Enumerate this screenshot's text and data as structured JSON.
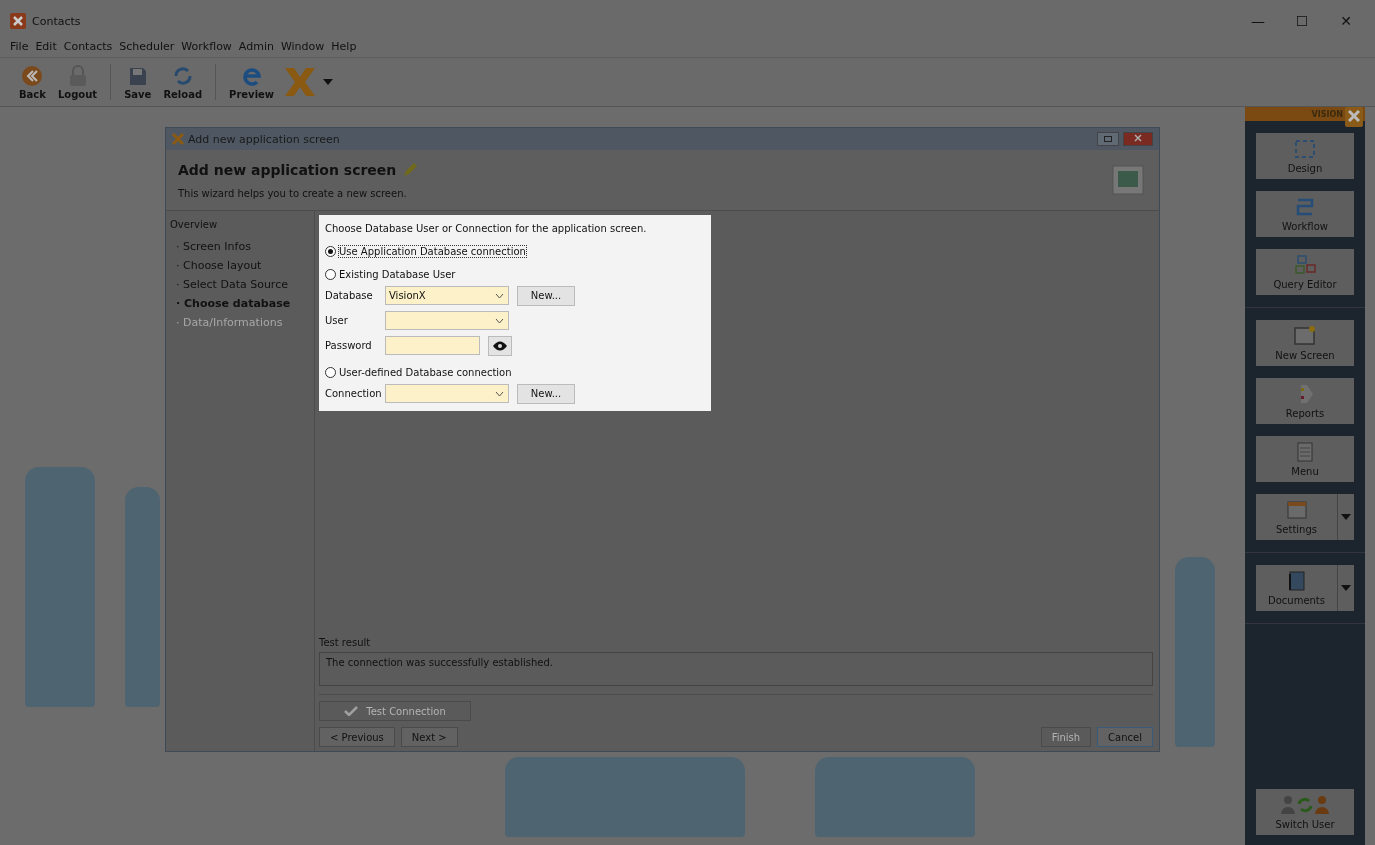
{
  "window": {
    "title": "Contacts",
    "controls": [
      "—",
      "☐",
      "✕"
    ]
  },
  "menu": [
    "File",
    "Edit",
    "Contacts",
    "Scheduler",
    "Workflow",
    "Admin",
    "Window",
    "Help"
  ],
  "toolbar": [
    {
      "kind": "back",
      "label": "Back"
    },
    {
      "kind": "lock",
      "label": "Logout"
    },
    {
      "kind": "sep"
    },
    {
      "kind": "save",
      "label": "Save"
    },
    {
      "kind": "reload",
      "label": "Reload"
    },
    {
      "kind": "sep"
    },
    {
      "kind": "preview",
      "label": "Preview"
    },
    {
      "kind": "logo"
    },
    {
      "kind": "caret"
    }
  ],
  "dialog": {
    "title": "Add new application screen",
    "heading": "Add new application screen",
    "subtitle": "This wizard helps you to create a new screen.",
    "nav_title": "Overview",
    "nav": [
      {
        "label": "· Screen Infos",
        "selected": false,
        "disabled": false
      },
      {
        "label": "· Choose layout",
        "selected": false,
        "disabled": false
      },
      {
        "label": "· Select Data Source",
        "selected": false,
        "disabled": false
      },
      {
        "label": "· Choose database",
        "selected": true,
        "disabled": false
      },
      {
        "label": "· Data/Informations",
        "selected": false,
        "disabled": true
      }
    ],
    "prompt": "Choose Database User or Connection for the application screen.",
    "sections": [
      {
        "label": "Use Application Database connection",
        "selected": true
      },
      {
        "label": "Existing Database User",
        "selected": false,
        "fields": [
          {
            "kind": "combo",
            "label": "Database",
            "value": "VisionX",
            "button": "New..."
          },
          {
            "kind": "combo",
            "label": "User"
          },
          {
            "kind": "password",
            "label": "Password"
          }
        ]
      },
      {
        "label": "User-defined Database connection",
        "selected": false,
        "fields": [
          {
            "kind": "combo",
            "label": "Connection",
            "button": "New..."
          }
        ]
      }
    ],
    "result_label": "Test result",
    "result_text": "The connection was successfully established.",
    "test_button": {
      "label": "Test Connection",
      "disabled": true
    },
    "left_buttons": [
      {
        "label": "< Previous",
        "disabled": false
      },
      {
        "label": "Next >",
        "disabled": false
      }
    ],
    "right_buttons": [
      {
        "label": "Finish",
        "disabled": true
      },
      {
        "label": "Cancel",
        "disabled": false
      }
    ]
  },
  "sidebar": {
    "brand": "VISION",
    "groups": [
      [
        {
          "kind": "design",
          "label": "Design",
          "dropdown": false
        },
        {
          "kind": "workflow",
          "label": "Workflow",
          "dropdown": false
        },
        {
          "kind": "query",
          "label": "Query Editor",
          "dropdown": false
        }
      ],
      [
        {
          "kind": "screen",
          "label": "New Screen",
          "dropdown": false
        },
        {
          "kind": "reports",
          "label": "Reports",
          "dropdown": false
        },
        {
          "kind": "menu",
          "label": "Menu",
          "dropdown": false
        },
        {
          "kind": "settings",
          "label": "Settings",
          "dropdown": true
        }
      ],
      [
        {
          "kind": "documents",
          "label": "Documents",
          "dropdown": true
        }
      ]
    ],
    "switch_user": "Switch User"
  }
}
